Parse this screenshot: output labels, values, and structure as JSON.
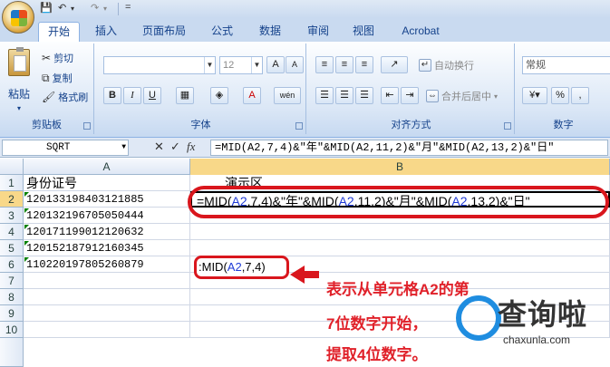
{
  "quick_access": {
    "customize_label": "="
  },
  "tabs": [
    "开始",
    "插入",
    "页面布局",
    "公式",
    "数据",
    "审阅",
    "视图",
    "Acrobat"
  ],
  "ribbon": {
    "clipboard": {
      "paste": "粘贴",
      "cut": "剪切",
      "copy": "复制",
      "format_painter": "格式刷",
      "label": "剪贴板"
    },
    "font": {
      "font_size": "12",
      "bold": "B",
      "italic": "I",
      "underline": "U",
      "phonetic": "wén",
      "grow": "A",
      "shrink": "A",
      "label": "字体"
    },
    "alignment": {
      "wrap_text": "自动换行",
      "merge_center": "合并后居中",
      "label": "对齐方式"
    },
    "number": {
      "format": "常规",
      "percent": "%",
      "comma": ",",
      "label": "数字"
    }
  },
  "formula_bar": {
    "name_box": "SQRT",
    "fx": "fx",
    "formula": "=MID(A2,7,4)&\"年\"&MID(A2,11,2)&\"月\"&MID(A2,13,2)&\"日\""
  },
  "sheet": {
    "columns": [
      "A",
      "B"
    ],
    "rows": [
      "1",
      "2",
      "3",
      "4",
      "5",
      "6",
      "7",
      "8",
      "9",
      "10"
    ],
    "a_header": "身份证号",
    "b_header": "演示区",
    "ids": [
      "120133198403121885",
      "120132196705050444",
      "120171199012120632",
      "120152187912160345",
      "110220197805260879"
    ],
    "b2_parts": [
      "=MID(",
      "A2",
      ",7,4)&\"年\"&MID(",
      "A2",
      ",11,2)&\"月\"&MID(",
      "A2",
      ",13,2)&\"日\""
    ],
    "mid_parts": [
      ":MID(",
      "A2",
      ",7,4)"
    ]
  },
  "annotation": [
    "表示从单元格A2的第",
    "7位数字开始，",
    "提取4位数字。"
  ],
  "watermark": {
    "title": "查询啦",
    "url": "chaxunla.com"
  },
  "colors": {
    "accent_red": "#d9161d",
    "annotation_red": "#e0212a",
    "ref_blue": "#1f3bd6",
    "ribbon_blue": "#15428b"
  }
}
